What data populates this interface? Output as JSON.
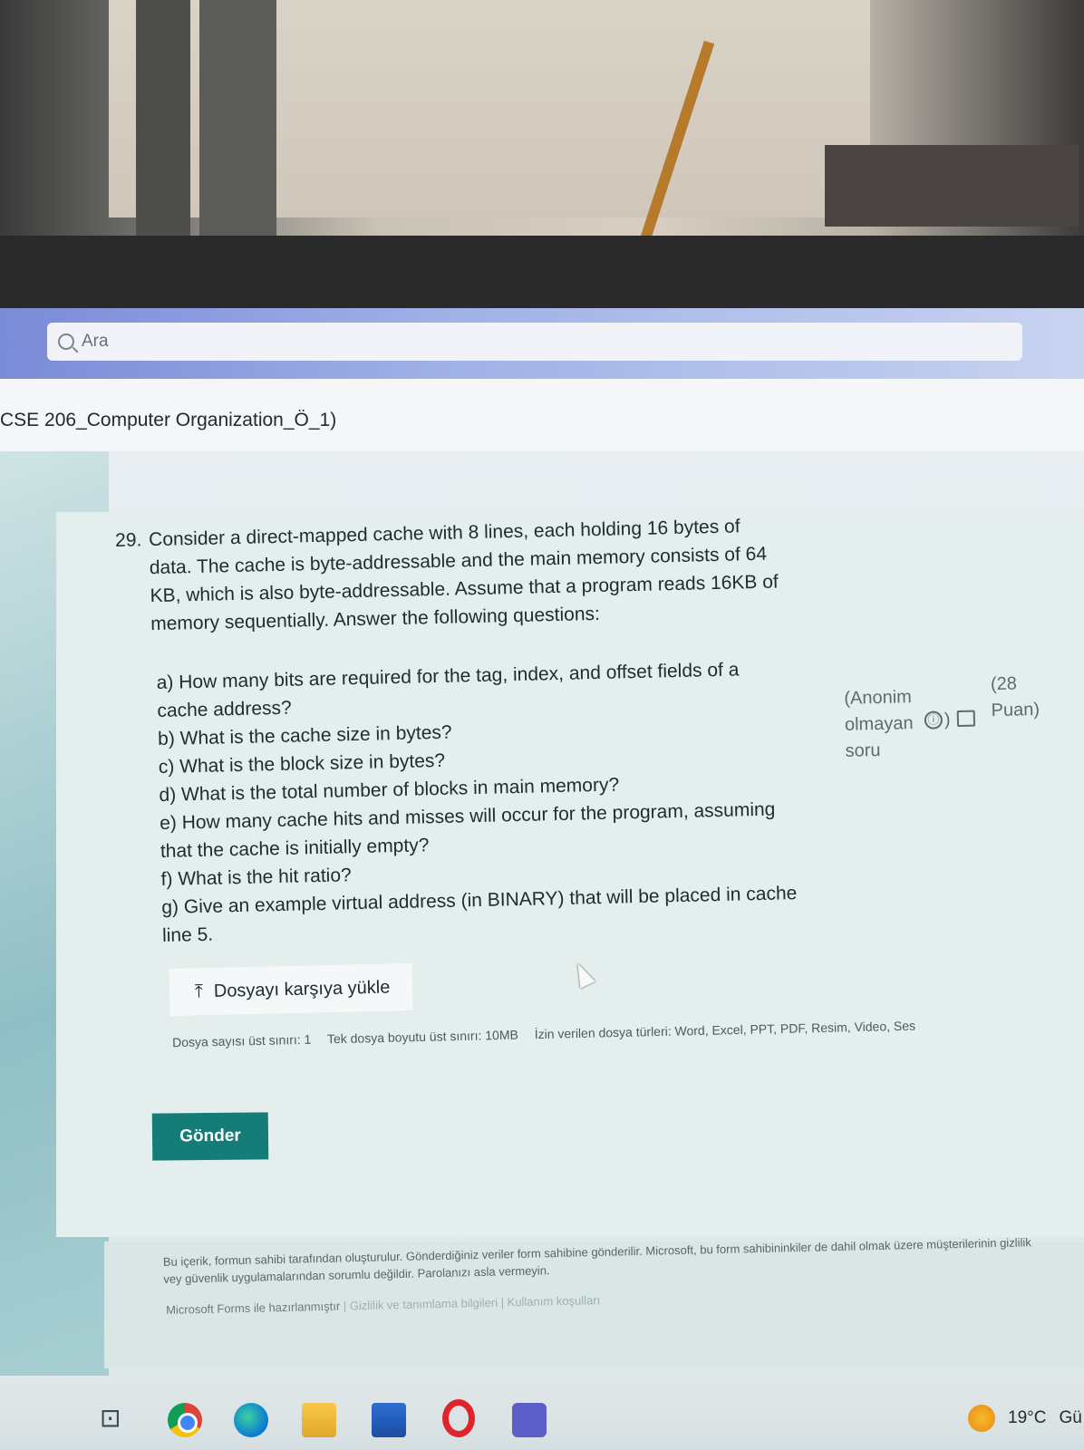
{
  "search": {
    "placeholder": "Ara"
  },
  "form": {
    "title": "CSE 206_Computer Organization_Ö_1)"
  },
  "question": {
    "number": "29.",
    "text": "Consider a direct-mapped cache with 8 lines, each holding 16 bytes of\ndata. The cache is byte-addressable and the main memory consists of 64\nKB, which is also byte-addressable. Assume that a program reads 16KB of\nmemory sequentially. Answer the following questions:",
    "subquestions": [
      "a) How many bits are required for the tag, index, and offset fields of a",
      "cache address?",
      "b) What is the cache size in bytes?",
      "c) What is the block size in bytes?",
      "d) What is the total number of blocks in main memory?",
      "e) How many cache hits and misses will occur for the program, assuming",
      "that the cache is initially empty?",
      "f) What is the hit ratio?",
      "g) Give an example  virtual address (in BINARY) that will be placed in cache",
      "line 5."
    ],
    "anonymity": "(Anonim olmayan soru",
    "info_glyph": "ⓘ",
    "paren_close": ")",
    "points": "(28 Puan)"
  },
  "upload": {
    "icon": "⤒",
    "label": "Dosyayı karşıya yükle",
    "limits": [
      "Dosya sayısı üst sınırı: 1",
      "Tek dosya boyutu üst sınırı: 10MB",
      "İzin verilen dosya türleri: Word, Excel, PPT, PDF, Resim, Video, Ses"
    ]
  },
  "submit": {
    "label": "Gönder"
  },
  "footer": {
    "disclaimer": "Bu içerik, formun sahibi tarafından oluşturulur. Gönderdiğiniz veriler form sahibine gönderilir. Microsoft, bu form sahibininkiler de dahil olmak üzere müşterilerinin gizlilik vey güvenlik uygulamalarından sorumlu değildir. Parolanızı asla vermeyin.",
    "made_with": "Microsoft Forms ile hazırlanmıştır",
    "privacy": "Gizlilik ve tanımlama bilgileri",
    "terms": "Kullanım koşulları",
    "separator": " | "
  },
  "taskbar": {
    "widgets_glyph": "⊡",
    "weather_temp": "19°C",
    "weather_text": "Gü"
  }
}
